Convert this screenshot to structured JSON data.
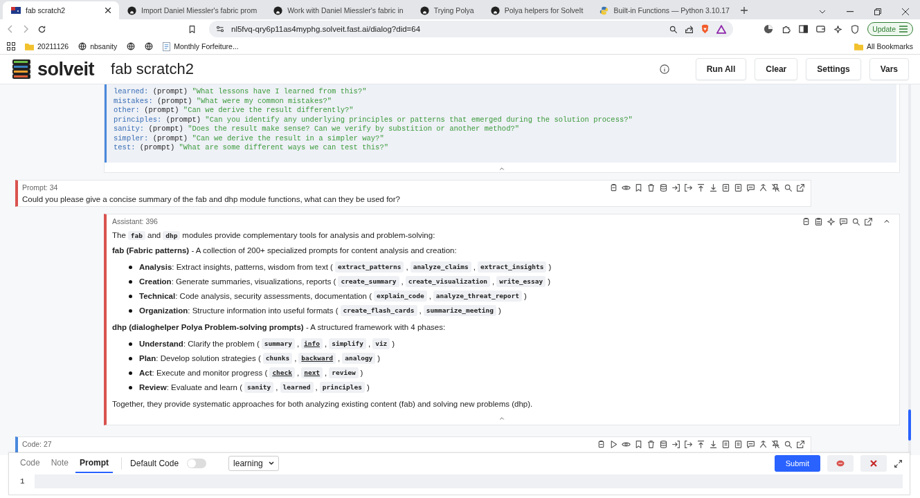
{
  "browser": {
    "tabs": [
      {
        "title": "fab scratch2",
        "selected": true
      },
      {
        "title": "Import Daniel Miessler's fabric prom",
        "selected": false
      },
      {
        "title": "Work with Daniel Miessler's fabric in",
        "selected": false
      },
      {
        "title": "Trying Polya",
        "selected": false
      },
      {
        "title": "Polya helpers for SolveIt",
        "selected": false
      },
      {
        "title": "Built-in Functions — Python 3.10.17",
        "selected": false
      }
    ],
    "url": "nl5fvq-qry6p11as4myphg.solveit.fast.ai/dialog?did=64",
    "bookmarks": [
      {
        "label": "20211126"
      },
      {
        "label": "nbsanity"
      },
      {
        "label": "Monthly Forfeiture..."
      }
    ],
    "all_bookmarks": "All Bookmarks",
    "update_button": "Update"
  },
  "app": {
    "logo": "solveit",
    "title": "fab scratch2",
    "buttons": [
      "Run All",
      "Clear",
      "Settings",
      "Vars"
    ]
  },
  "output_cell": {
    "lines": [
      {
        "key": "learned:",
        "type": "(prompt)",
        "text": "\"What lessons have I learned from this?\""
      },
      {
        "key": "mistakes:",
        "type": "(prompt)",
        "text": "\"What were my common mistakes?\""
      },
      {
        "key": "other:",
        "type": "(prompt)",
        "text": "\"Can we derive the result differently?\""
      },
      {
        "key": "principles:",
        "type": "(prompt)",
        "text": "\"Can you identify any underlying principles or patterns that emerged during the solution process?\""
      },
      {
        "key": "sanity:",
        "type": "(prompt)",
        "text": "\"Does the result make sense? Can we verify by substition or another method?\""
      },
      {
        "key": "simpler:",
        "type": "(prompt)",
        "text": "\"Can we derive the result in a simpler way?\""
      },
      {
        "key": "test:",
        "type": "(prompt)",
        "text": "\"What are some different ways we can test this?\""
      }
    ]
  },
  "prompt_cell": {
    "label": "Prompt: 34",
    "text": "Could you please give a concise summary of the fab and dhp module functions, what can they be used for?"
  },
  "assistant_cell": {
    "label": "Assistant: 396",
    "blocks": [
      {
        "kind": "para",
        "segments": [
          {
            "kind": "text",
            "text": "The"
          },
          {
            "kind": "code",
            "text": "fab"
          },
          {
            "kind": "text",
            "text": "and"
          },
          {
            "kind": "code",
            "text": "dhp"
          },
          {
            "kind": "text",
            "text": "modules provide complementary tools for analysis and problem-solving:"
          }
        ]
      },
      {
        "kind": "para",
        "segments": [
          {
            "kind": "bold",
            "text": "fab (Fabric patterns)"
          },
          {
            "kind": "text",
            "text": "- A collection of 200+ specialized prompts for content analysis and creation:"
          }
        ]
      },
      {
        "kind": "list",
        "items": [
          {
            "segments": [
              {
                "kind": "bold",
                "text": "Analysis"
              },
              {
                "kind": "text",
                "text": ": Extract insights, patterns, wisdom from text ("
              },
              {
                "kind": "code",
                "text": "extract_patterns"
              },
              {
                "kind": "text",
                "text": ","
              },
              {
                "kind": "code",
                "text": "analyze_claims"
              },
              {
                "kind": "text",
                "text": ","
              },
              {
                "kind": "code",
                "text": "extract_insights"
              },
              {
                "kind": "text",
                "text": ")"
              }
            ]
          },
          {
            "segments": [
              {
                "kind": "bold",
                "text": "Creation"
              },
              {
                "kind": "text",
                "text": ": Generate summaries, visualizations, reports ("
              },
              {
                "kind": "code",
                "text": "create_summary"
              },
              {
                "kind": "text",
                "text": ","
              },
              {
                "kind": "code",
                "text": "create_visualization"
              },
              {
                "kind": "text",
                "text": ","
              },
              {
                "kind": "code",
                "text": "write_essay"
              },
              {
                "kind": "text",
                "text": ")"
              }
            ]
          },
          {
            "segments": [
              {
                "kind": "bold",
                "text": "Technical"
              },
              {
                "kind": "text",
                "text": ": Code analysis, security assessments, documentation ("
              },
              {
                "kind": "code",
                "text": "explain_code"
              },
              {
                "kind": "text",
                "text": ","
              },
              {
                "kind": "code",
                "text": "analyze_threat_report"
              },
              {
                "kind": "text",
                "text": ")"
              }
            ]
          },
          {
            "segments": [
              {
                "kind": "bold",
                "text": "Organization"
              },
              {
                "kind": "text",
                "text": ": Structure information into useful formats ("
              },
              {
                "kind": "code",
                "text": "create_flash_cards"
              },
              {
                "kind": "text",
                "text": ","
              },
              {
                "kind": "code",
                "text": "summarize_meeting"
              },
              {
                "kind": "text",
                "text": ")"
              }
            ]
          }
        ]
      },
      {
        "kind": "para",
        "segments": [
          {
            "kind": "bold",
            "text": "dhp (dialoghelper Polya Problem-solving prompts)"
          },
          {
            "kind": "text",
            "text": "- A structured framework with 4 phases:"
          }
        ]
      },
      {
        "kind": "list",
        "items": [
          {
            "segments": [
              {
                "kind": "bold",
                "text": "Understand"
              },
              {
                "kind": "text",
                "text": ": Clarify the problem ("
              },
              {
                "kind": "code",
                "text": "summary"
              },
              {
                "kind": "text",
                "text": ","
              },
              {
                "kind": "link",
                "text": "info"
              },
              {
                "kind": "text",
                "text": ","
              },
              {
                "kind": "code",
                "text": "simplify"
              },
              {
                "kind": "text",
                "text": ","
              },
              {
                "kind": "code",
                "text": "viz"
              },
              {
                "kind": "text",
                "text": ")"
              }
            ]
          },
          {
            "segments": [
              {
                "kind": "bold",
                "text": "Plan"
              },
              {
                "kind": "text",
                "text": ": Develop solution strategies ("
              },
              {
                "kind": "code",
                "text": "chunks"
              },
              {
                "kind": "text",
                "text": ","
              },
              {
                "kind": "link",
                "text": "backward"
              },
              {
                "kind": "text",
                "text": ","
              },
              {
                "kind": "code",
                "text": "analogy"
              },
              {
                "kind": "text",
                "text": ")"
              }
            ]
          },
          {
            "segments": [
              {
                "kind": "bold",
                "text": "Act"
              },
              {
                "kind": "text",
                "text": ": Execute and monitor progress ("
              },
              {
                "kind": "link",
                "text": "check"
              },
              {
                "kind": "text",
                "text": ","
              },
              {
                "kind": "link",
                "text": "next"
              },
              {
                "kind": "text",
                "text": ","
              },
              {
                "kind": "code",
                "text": "review"
              },
              {
                "kind": "text",
                "text": ")"
              }
            ]
          },
          {
            "segments": [
              {
                "kind": "bold",
                "text": "Review"
              },
              {
                "kind": "text",
                "text": ": Evaluate and learn ("
              },
              {
                "kind": "code",
                "text": "sanity"
              },
              {
                "kind": "text",
                "text": ","
              },
              {
                "kind": "code",
                "text": "learned"
              },
              {
                "kind": "text",
                "text": ","
              },
              {
                "kind": "code",
                "text": "principles"
              },
              {
                "kind": "text",
                "text": ")"
              }
            ]
          }
        ]
      },
      {
        "kind": "para",
        "segments": [
          {
            "kind": "text",
            "text": "Together, they provide systematic approaches for both analyzing existing content (fab) and solving new problems (dhp)."
          }
        ]
      }
    ]
  },
  "code_cell": {
    "label": "Code: 27"
  },
  "editor": {
    "tabs": [
      {
        "label": "Code",
        "selected": false
      },
      {
        "label": "Note",
        "selected": false
      },
      {
        "label": "Prompt",
        "selected": true
      }
    ],
    "default_code": {
      "label": "Default Code",
      "on": false
    },
    "mode": "learning",
    "submit": "Submit",
    "line_number": "1"
  }
}
